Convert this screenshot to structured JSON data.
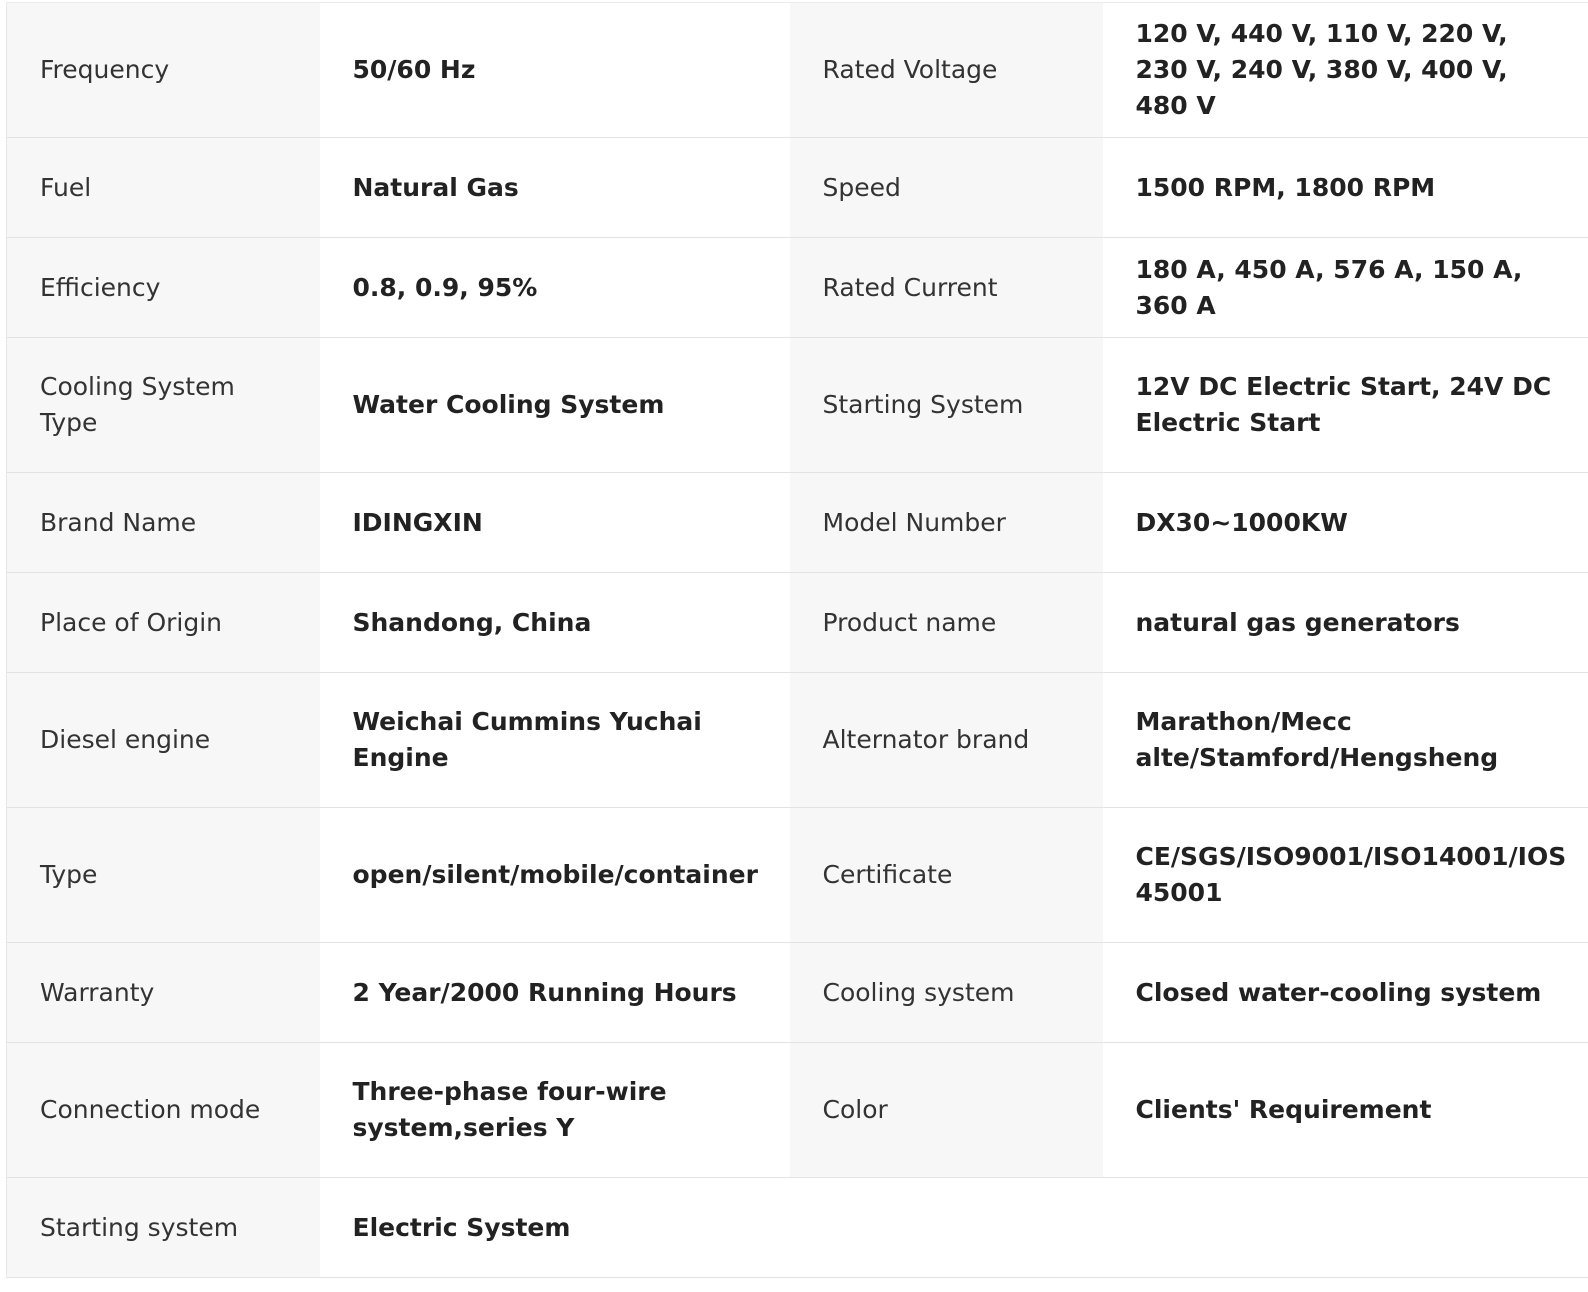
{
  "specs": {
    "rows": [
      {
        "left_label": "Frequency",
        "left_value": "50/60 Hz",
        "right_label": "Rated Voltage",
        "right_value": "120 V, 440 V, 110 V, 220 V, 230 V, 240 V, 380 V, 400 V, 480 V"
      },
      {
        "left_label": "Fuel",
        "left_value": "Natural Gas",
        "right_label": "Speed",
        "right_value": "1500 RPM, 1800 RPM"
      },
      {
        "left_label": "Efficiency",
        "left_value": "0.8, 0.9, 95%",
        "right_label": "Rated Current",
        "right_value": "180 A, 450 A, 576 A, 150 A, 360 A"
      },
      {
        "left_label": "Cooling System Type",
        "left_value": "Water Cooling System",
        "right_label": "Starting System",
        "right_value": "12V DC Electric Start, 24V DC Electric Start"
      },
      {
        "left_label": "Brand Name",
        "left_value": "IDINGXIN",
        "right_label": "Model Number",
        "right_value": "DX30~1000KW"
      },
      {
        "left_label": "Place of Origin",
        "left_value": "Shandong, China",
        "right_label": "Product name",
        "right_value": "natural gas generators"
      },
      {
        "left_label": "Diesel engine",
        "left_value": "Weichai Cummins Yuchai Engine",
        "right_label": "Alternator brand",
        "right_value": "Marathon/Mecc alte/Stamford/Hengsheng"
      },
      {
        "left_label": "Type",
        "left_value": "open/silent/mobile/container",
        "right_label": "Certificate",
        "right_value": "CE/SGS/ISO9001/ISO14001/IOS 45001"
      },
      {
        "left_label": "Warranty",
        "left_value": "2 Year/2000 Running Hours",
        "right_label": "Cooling system",
        "right_value": "Closed water-cooling system"
      },
      {
        "left_label": "Connection mode",
        "left_value": "Three-phase four-wire system,series Y",
        "right_label": "Color",
        "right_value": "Clients' Requirement"
      },
      {
        "left_label": "Starting system",
        "left_value": "Electric System"
      }
    ]
  }
}
